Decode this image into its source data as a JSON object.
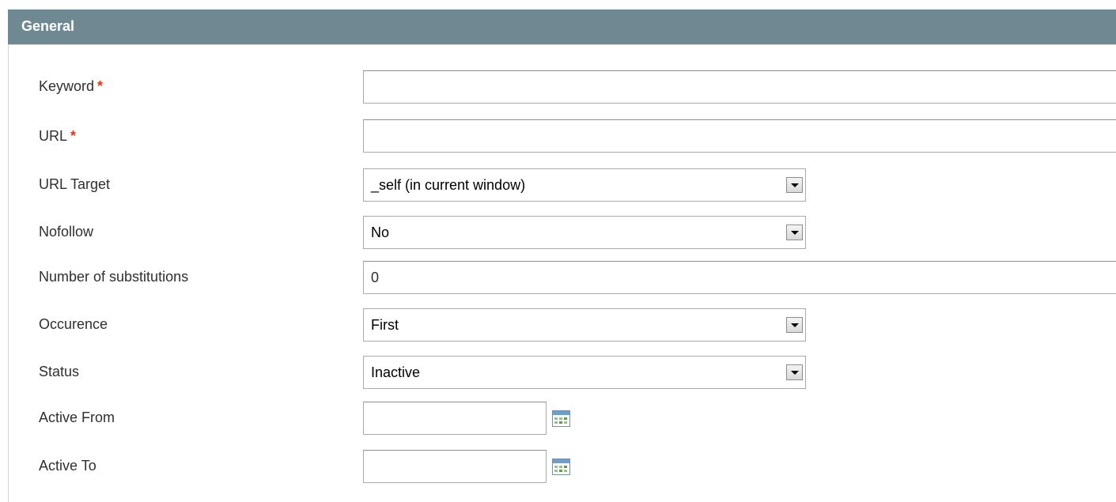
{
  "fieldset": {
    "title": "General"
  },
  "required_marker": "*",
  "colors": {
    "header_bg": "#6f8992",
    "required": "#eb340a"
  },
  "fields": {
    "keyword": {
      "label": "Keyword",
      "value": "",
      "required": true
    },
    "url": {
      "label": "URL",
      "value": "",
      "required": true
    },
    "url_target": {
      "label": "URL Target",
      "selected": "_self (in current window)"
    },
    "nofollow": {
      "label": "Nofollow",
      "selected": "No"
    },
    "substitutions": {
      "label": "Number of substitutions",
      "value": "0"
    },
    "occurence": {
      "label": "Occurence",
      "selected": "First"
    },
    "status": {
      "label": "Status",
      "selected": "Inactive"
    },
    "active_from": {
      "label": "Active From",
      "value": "",
      "icon": "calendar-icon"
    },
    "active_to": {
      "label": "Active To",
      "value": "",
      "icon": "calendar-icon"
    }
  }
}
